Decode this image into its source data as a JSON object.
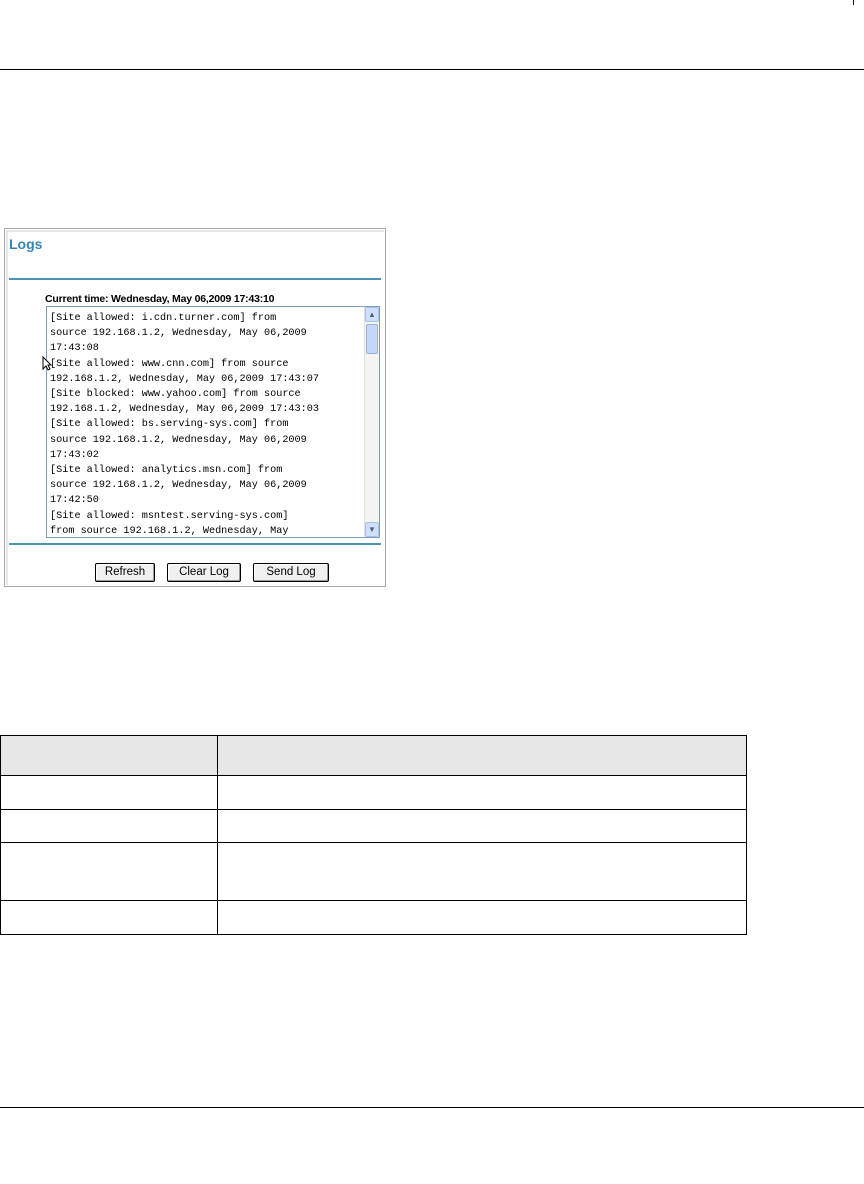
{
  "logs_panel": {
    "title": "Logs",
    "current_time": "Current time: Wednesday, May 06,2009 17:43:10",
    "log_text": "[Site allowed: i.cdn.turner.com] from\nsource 192.168.1.2, Wednesday, May 06,2009\n17:43:08\n[Site allowed: www.cnn.com] from source\n192.168.1.2, Wednesday, May 06,2009 17:43:07\n[Site blocked: www.yahoo.com] from source\n192.168.1.2, Wednesday, May 06,2009 17:43:03\n[Site allowed: bs.serving-sys.com] from\nsource 192.168.1.2, Wednesday, May 06,2009\n17:43:02\n[Site allowed: analytics.msn.com] from\nsource 192.168.1.2, Wednesday, May 06,2009\n17:42:50\n[Site allowed: msntest.serving-sys.com]\nfrom source 192.168.1.2, Wednesday, May",
    "buttons": {
      "refresh": "Refresh",
      "clear_log": "Clear Log",
      "send_log": "Send Log"
    },
    "colors": {
      "title": "#3384b8",
      "rule": "#4a93b3"
    }
  },
  "table": {
    "header": [
      "",
      ""
    ],
    "rows": [
      [
        "",
        ""
      ],
      [
        "",
        ""
      ],
      [
        "",
        ""
      ],
      [
        "",
        ""
      ]
    ]
  }
}
